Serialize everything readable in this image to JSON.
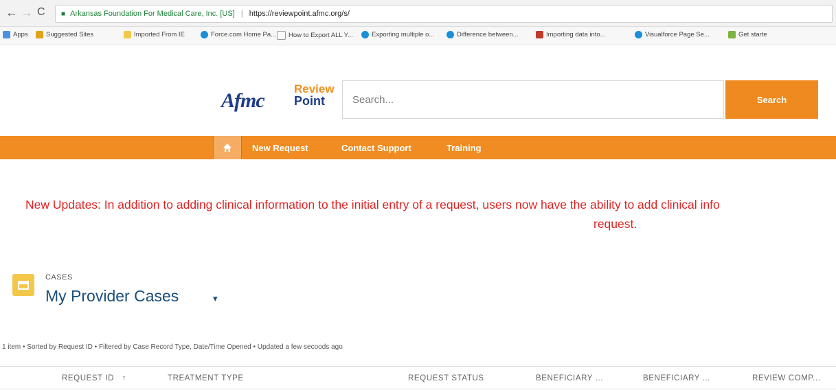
{
  "browser": {
    "nav": {
      "back": "←",
      "forward": "→",
      "reload": "C"
    },
    "site_name": "Arkansas Foundation For Medical Care, Inc. [US]",
    "url": "https://reviewpoint.afmc.org/s/",
    "bookmarks": [
      {
        "label": "Apps",
        "icon_color": "#4a90e2"
      },
      {
        "label": "Suggested Sites",
        "icon_color": "#e2a31a"
      },
      {
        "label": "Imported From IE",
        "icon_color": "#f3c84a"
      },
      {
        "label": "Force.com Home Pa...",
        "icon_color": "#1a8fd8"
      },
      {
        "label": "How to Export ALL Y...",
        "icon_color": "#cccccc"
      },
      {
        "label": "Exporting multiple o...",
        "icon_color": "#1a8fd8"
      },
      {
        "label": "Difference between...",
        "icon_color": "#1a8fd8"
      },
      {
        "label": "Importing data into...",
        "icon_color": "#c0392b"
      },
      {
        "label": "Visualforce Page Se...",
        "icon_color": "#1a8fd8"
      },
      {
        "label": "Get starte",
        "icon_color": "#7cb342"
      }
    ]
  },
  "header": {
    "logo_main": "Afmc",
    "logo_review": "Review",
    "logo_point": "Point",
    "search_placeholder": "Search...",
    "search_button": "Search"
  },
  "nav": {
    "home_icon": "home-icon",
    "items": [
      "New Request",
      "Contact Support",
      "Training"
    ]
  },
  "banner": {
    "line1": "New Updates:  In addition to adding clinical information to the initial entry of a request, users now have the ability to add clinical info",
    "line2": "request."
  },
  "cases": {
    "label": "CASES",
    "title": "My Provider Cases",
    "caret": "▾",
    "meta": "1 item • Sorted by Request ID • Filtered by Case Record Type, Date/Time Opened • Updated a few secoods ago"
  },
  "table": {
    "columns": [
      {
        "label": "REQUEST ID",
        "sort": "↑"
      },
      {
        "label": "TREATMENT TYPE",
        "sort": ""
      },
      {
        "label": "REQUEST STATUS",
        "sort": ""
      },
      {
        "label": "BENEFICIARY ...",
        "sort": ""
      },
      {
        "label": "BENEFICIARY ...",
        "sort": ""
      },
      {
        "label": "REVIEW COMP...",
        "sort": ""
      }
    ]
  },
  "colors": {
    "orange": "#ef8a21",
    "banner_red": "#e02424",
    "title_blue": "#1a4e7a"
  }
}
